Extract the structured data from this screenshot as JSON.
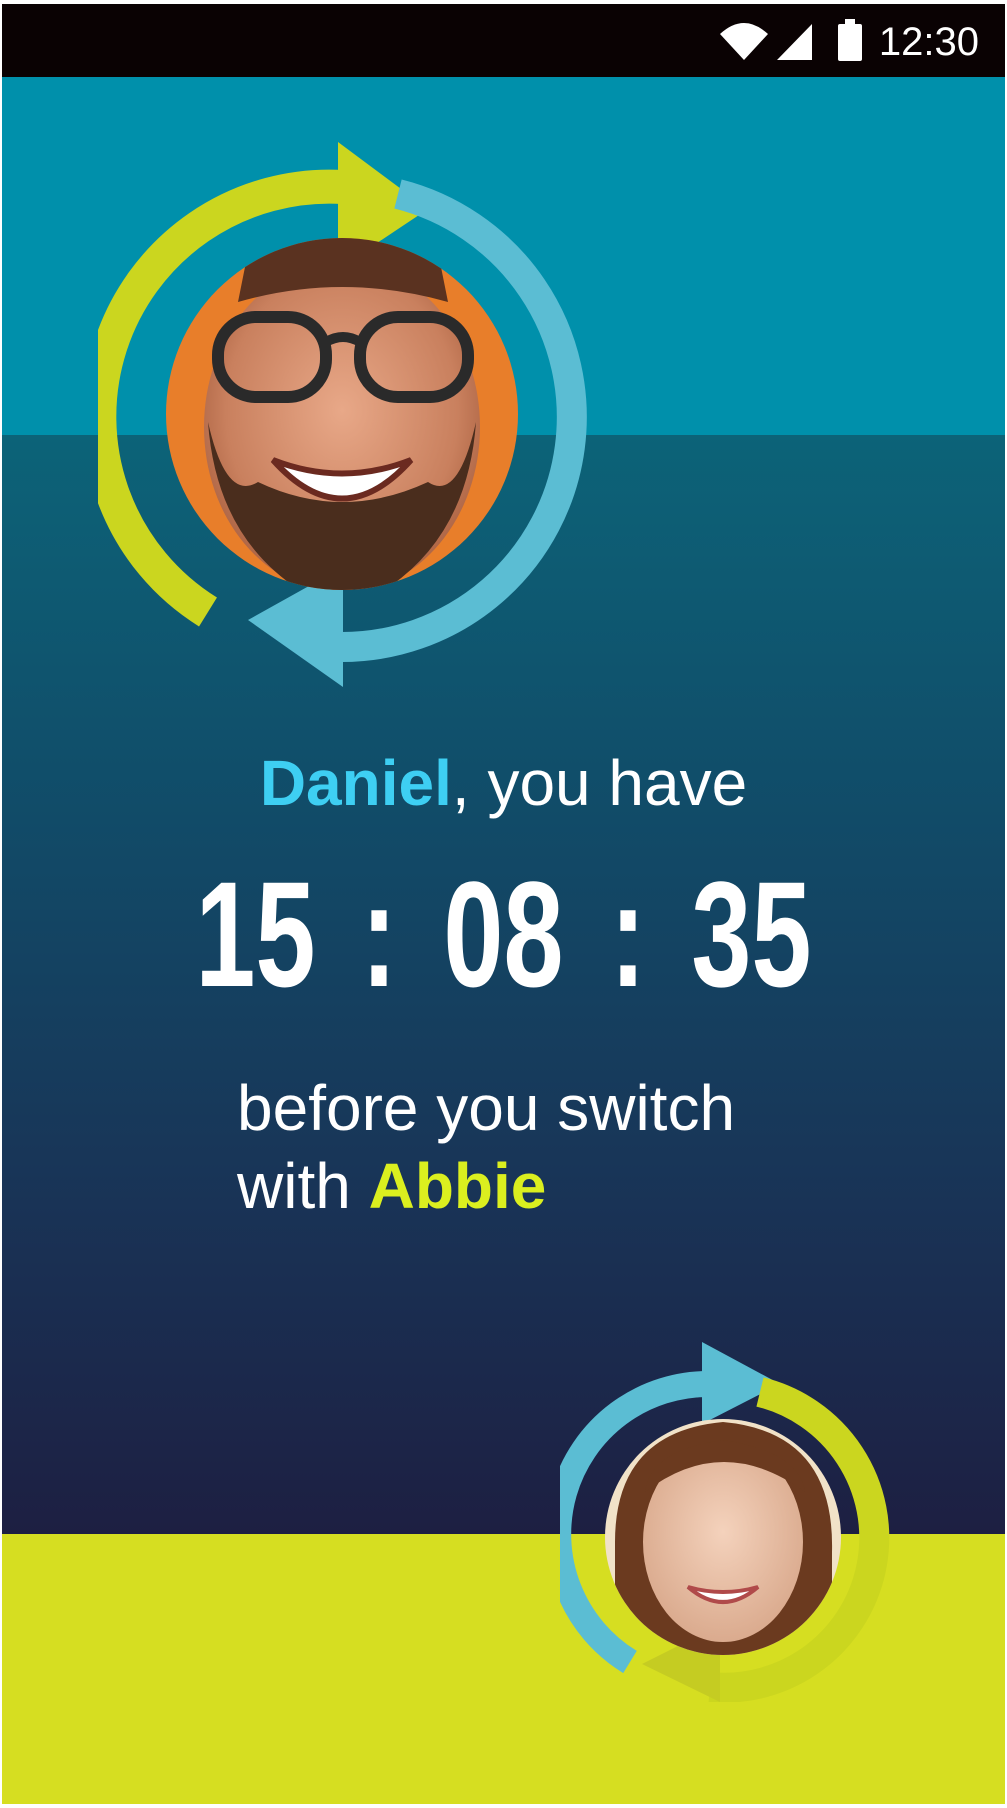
{
  "status_bar": {
    "time": "12:30",
    "icons": [
      "wifi-icon",
      "cell-signal-icon",
      "battery-icon"
    ],
    "background": "#0a0203"
  },
  "countdown": {
    "user_name": "Daniel",
    "greeting_suffix": ", you have",
    "hours": "15",
    "minutes": "08",
    "seconds": "35",
    "separator": ":",
    "message_line1": "before you switch",
    "message_line2_prefix": "with ",
    "partner_name": "Abbie"
  },
  "colors": {
    "top_band": "#0090ab",
    "bottom_band": "#d6de21",
    "name_highlight": "#3ecff3",
    "partner_highlight": "#dbef1f",
    "arrow_lime": "#cbd61f",
    "arrow_blue": "#5bbdd3"
  },
  "avatars": [
    {
      "role": "current-user",
      "depicts": "smiling man with glasses"
    },
    {
      "role": "partner",
      "depicts": "smiling woman"
    }
  ]
}
